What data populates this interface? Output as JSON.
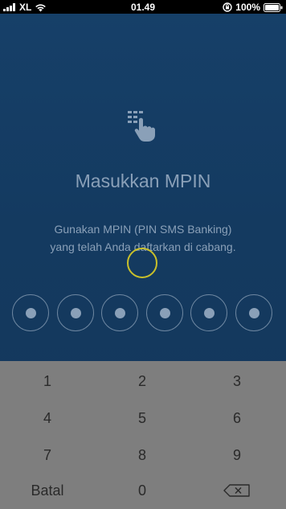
{
  "status_bar": {
    "carrier": "XL",
    "time": "01.49",
    "battery": "100%",
    "icons": [
      "signal-icon",
      "wifi-icon",
      "orientation-lock-icon",
      "battery-icon"
    ]
  },
  "main": {
    "icon": "hand-keypad-icon",
    "title": "Masukkan MPIN",
    "instruction_line1": "Gunakan MPIN (PIN SMS Banking)",
    "instruction_line2": "yang telah Anda daftarkan di cabang.",
    "pin_digits_entered": 6,
    "pin_length": 6
  },
  "keypad": {
    "keys": [
      {
        "label": "1"
      },
      {
        "label": "2"
      },
      {
        "label": "3"
      },
      {
        "label": "4"
      },
      {
        "label": "5"
      },
      {
        "label": "6"
      },
      {
        "label": "7"
      },
      {
        "label": "8"
      },
      {
        "label": "9"
      },
      {
        "label": "Batal"
      },
      {
        "label": "0"
      },
      {
        "label": "",
        "icon": "backspace-icon"
      }
    ]
  },
  "colors": {
    "background": "#143a60",
    "text": "#8aa0b8",
    "keypad": "#7e7e7e",
    "loading_ring": "#c9c02a"
  }
}
